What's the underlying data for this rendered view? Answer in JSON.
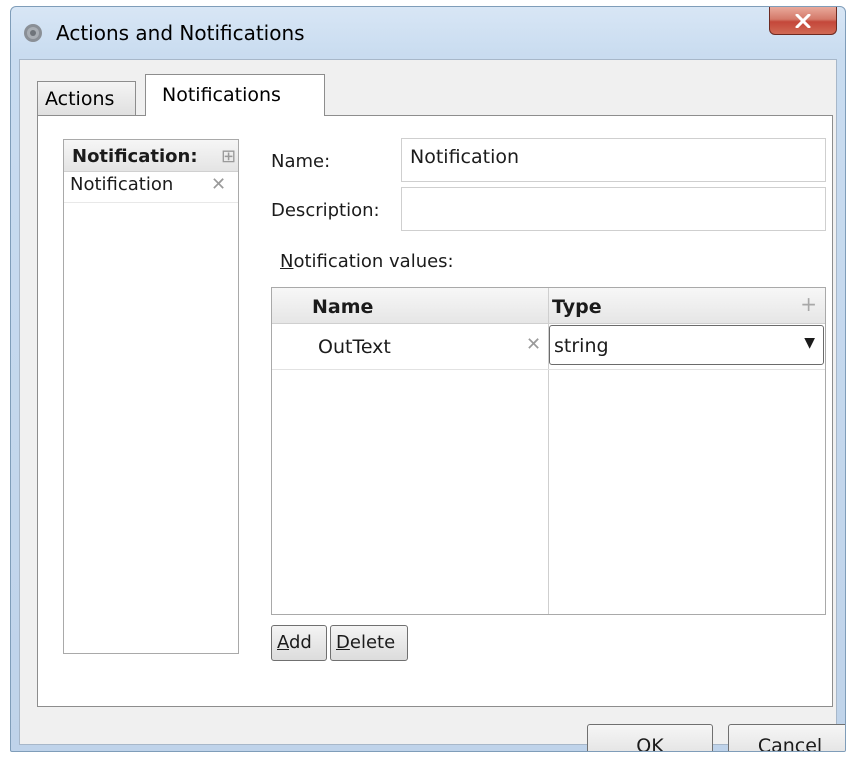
{
  "window": {
    "title": "Actions and Notifications",
    "icon": "gear-icon",
    "close_icon": "close-icon",
    "accent_close": "#c4473a"
  },
  "tabs": [
    {
      "label": "Actions",
      "selected": false
    },
    {
      "label": "Notifications",
      "selected": true
    }
  ],
  "notification_list": {
    "header": "Notification:",
    "header_icon": "add-icon",
    "items": [
      {
        "label": "Notification",
        "delete_icon": "delete-icon"
      }
    ]
  },
  "form": {
    "name_label": "Name:",
    "name_value": "Notification",
    "description_label": "Description:",
    "description_value": "",
    "values_label_accel": "N",
    "values_label_rest": "otification values:"
  },
  "grid": {
    "columns": [
      "Name",
      "Type"
    ],
    "add_icon": "add-icon",
    "rows": [
      {
        "name": "OutText",
        "type": "string"
      }
    ]
  },
  "buttons": {
    "add_accel": "A",
    "add_rest": "dd",
    "delete_accel": "D",
    "delete_rest": "elete",
    "ok": "OK",
    "cancel": "Cancel"
  }
}
